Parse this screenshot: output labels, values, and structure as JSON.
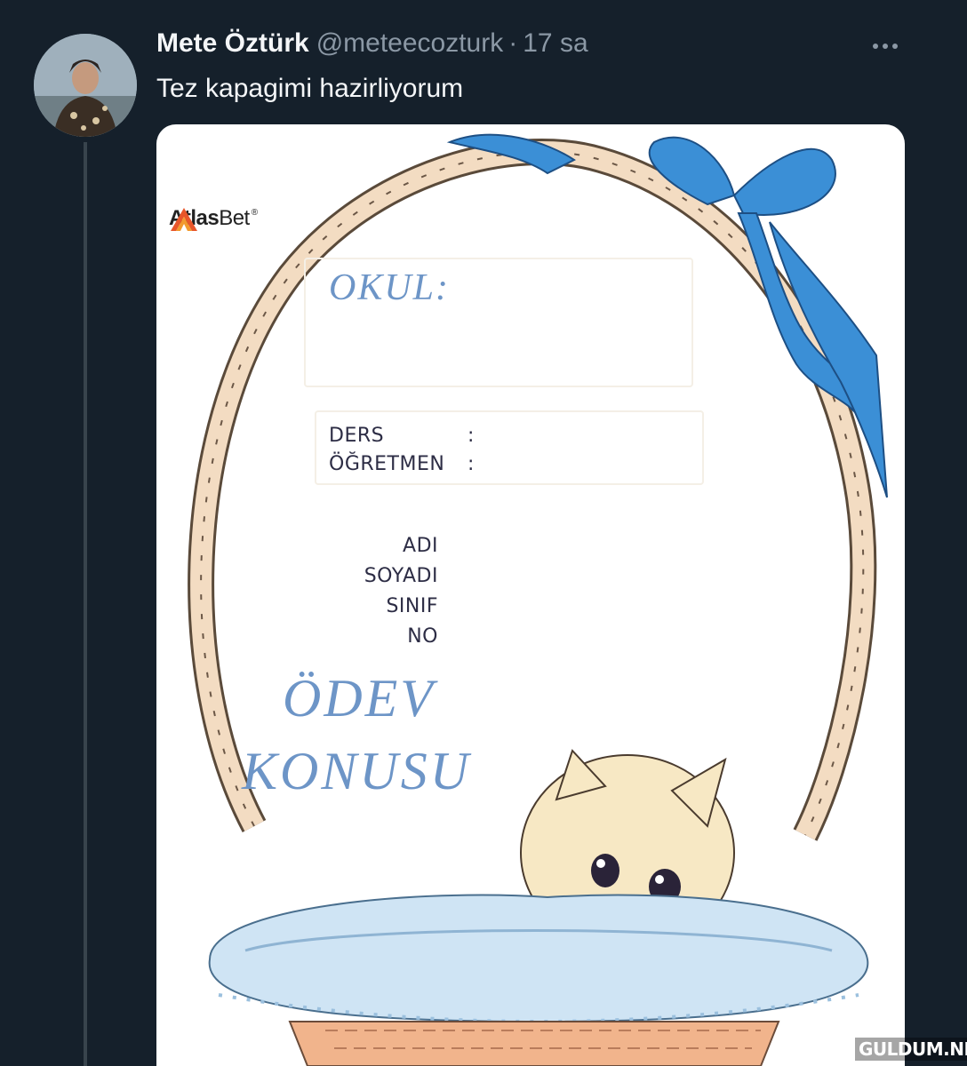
{
  "tweet": {
    "author_name": "Mete Öztürk",
    "author_handle": "@meteecozturk",
    "separator": "·",
    "time": "17 sa",
    "text": "Tez kapagimi hazirliyorum",
    "more_icon": "more-horizontal-icon"
  },
  "media": {
    "logo": {
      "brand_bold": "Atlas",
      "brand_light": "Bet",
      "registered": "®",
      "icon": "atlasbet-logo-icon"
    },
    "form": {
      "okul_label": "OKUL:",
      "ders_label": "DERS",
      "ogretmen_label": "ÖĞRETMEN",
      "colon": ":",
      "student_fields": [
        "ADI",
        "SOYADI",
        "SINIF",
        "NO"
      ],
      "title_line1": "ÖDEV",
      "title_line2": "KONUSU"
    },
    "colors": {
      "accent_blue": "#6d95c7",
      "ribbon_blue": "#3b8fd6",
      "basket": "#e8c9a8"
    }
  },
  "watermark": "GULDUM.NET"
}
